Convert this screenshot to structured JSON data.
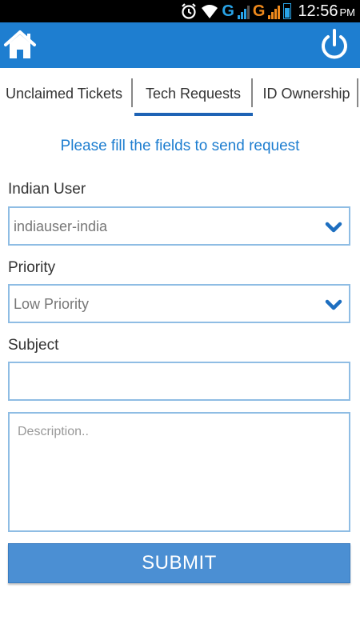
{
  "status_bar": {
    "network_1": "G",
    "network_2": "G",
    "time": "12:56",
    "ampm": "PM",
    "icons": [
      "alarm-icon",
      "wifi-icon",
      "signal-icon",
      "signal-icon",
      "battery-icon"
    ]
  },
  "app_bar": {
    "home_icon": "home-icon",
    "power_icon": "power-icon",
    "bar_color": "#1e7ed0"
  },
  "tabs": [
    {
      "label": "Unclaimed Tickets",
      "active": false
    },
    {
      "label": "Tech Requests",
      "active": true
    },
    {
      "label": "ID Ownership",
      "active": false
    }
  ],
  "form": {
    "instruction": "Please fill the fields to send request",
    "user_label": "Indian User",
    "user_value": "indiauser-india",
    "priority_label": "Priority",
    "priority_value": "Low Priority",
    "subject_label": "Subject",
    "subject_value": "",
    "description_placeholder": "Description..",
    "submit_label": "SUBMIT"
  },
  "colors": {
    "accent": "#1e7ed0",
    "field_border": "#8fbde4",
    "submit_bg": "#4b8fd3",
    "tab_indicator": "#1e63b5"
  }
}
